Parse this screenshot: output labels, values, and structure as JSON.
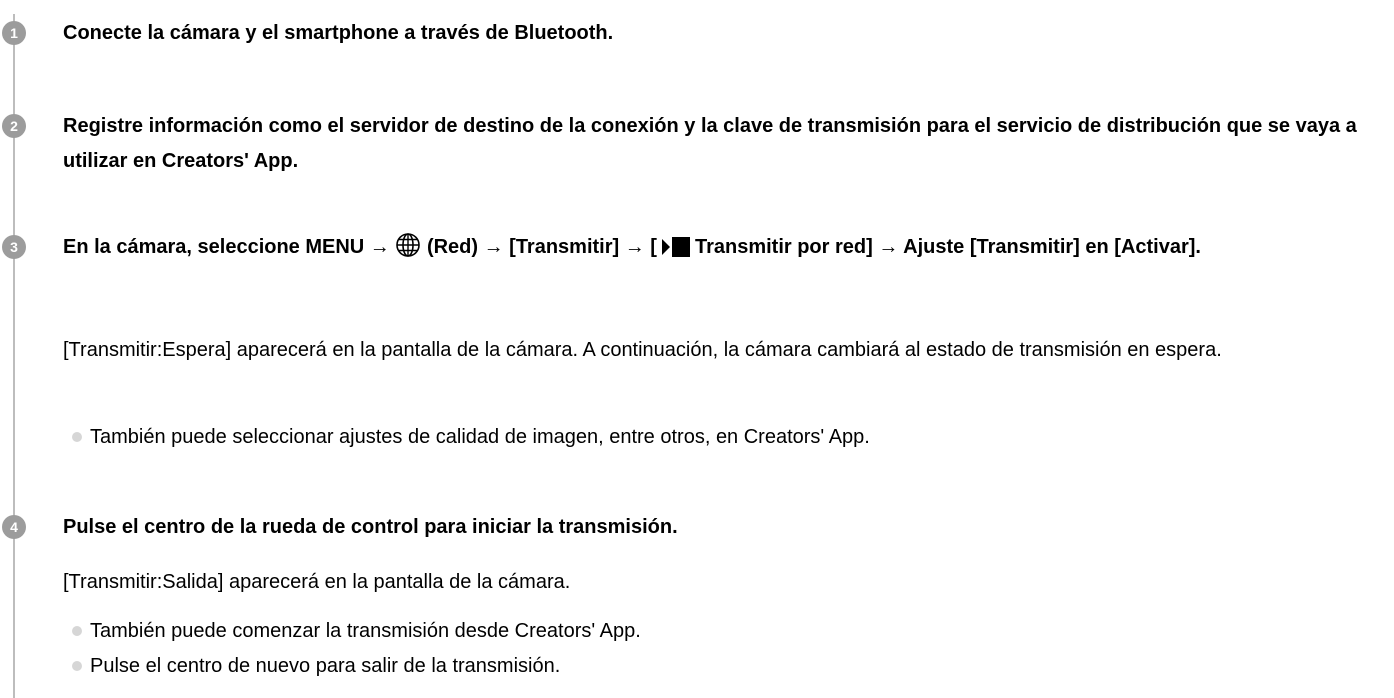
{
  "steps": [
    {
      "number": "1",
      "title": "Conecte la cámara y el smartphone a través de Bluetooth."
    },
    {
      "number": "2",
      "title": "Registre información como el servidor de destino de la conexión y la clave de transmisión para el servicio de distribución que se vaya a utilizar en Creators' App."
    },
    {
      "number": "3",
      "title_parts": {
        "a": "En la cámara, seleccione MENU →",
        "b": "(Red) → [Transmitir] → [",
        "c": "Transmitir por red] → Ajuste [Transmitir] en [Activar]."
      },
      "icons": [
        "globe-network-icon",
        "stream-icon"
      ],
      "description": "[Transmitir:Espera] aparecerá en la pantalla de la cámara. A continuación, la cámara cambiará al estado de transmisión en espera.",
      "bullets": [
        "También puede seleccionar ajustes de calidad de imagen, entre otros, en Creators' App."
      ]
    },
    {
      "number": "4",
      "title": "Pulse el centro de la rueda de control para iniciar la transmisión.",
      "description": "[Transmitir:Salida] aparecerá en la pantalla de la cámara.",
      "bullets": [
        "También puede comenzar la transmisión desde Creators' App.",
        "Pulse el centro de nuevo para salir de la transmisión."
      ]
    }
  ],
  "colors": {
    "step_circle": "#9c9c9c",
    "timeline": "#bdbdbd",
    "bullet_dot": "#d6d6d6",
    "text": "#000000"
  }
}
